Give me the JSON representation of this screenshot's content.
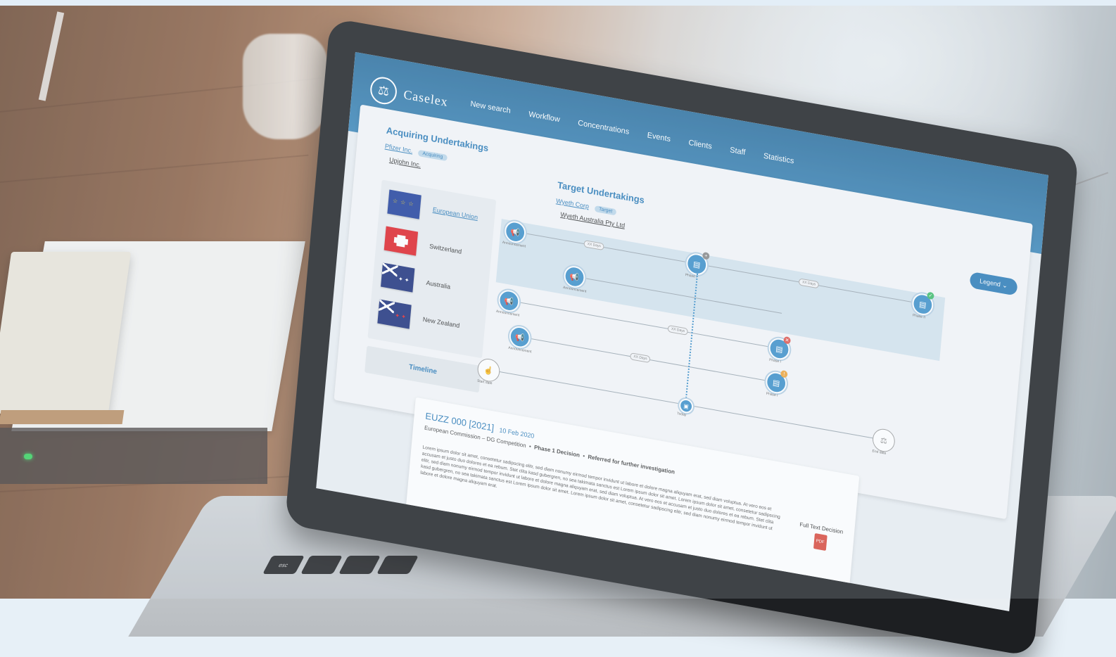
{
  "app": {
    "logo_text": "Caselex",
    "logo_icon": "scales-icon"
  },
  "nav": [
    {
      "label": "New search"
    },
    {
      "label": "Workflow"
    },
    {
      "label": "Concentrations"
    },
    {
      "label": "Events"
    },
    {
      "label": "Clients"
    },
    {
      "label": "Staff"
    },
    {
      "label": "Statistics"
    }
  ],
  "acquiring": {
    "title": "Acquiring Undertakings",
    "primary": "Pfizer Inc.",
    "tag": "Acquiring",
    "secondary": "Upjohn Inc."
  },
  "target": {
    "title": "Target Undertakings",
    "primary": "Wyeth Corp",
    "tag": "Target",
    "secondary": "Wyeth Australia Pty Ltd"
  },
  "countries": [
    {
      "name": "European Union",
      "flag": "eu-flag-icon"
    },
    {
      "name": "Switzerland",
      "flag": "switzerland-flag-icon"
    },
    {
      "name": "Australia",
      "flag": "australia-flag-icon"
    },
    {
      "name": "New Zealand",
      "flag": "new-zealand-flag-icon"
    }
  ],
  "timeline_label": "Timeline",
  "legend_label": "Legend",
  "graph": {
    "announcement": "Announcement",
    "pill_a": "XX Days",
    "pill_b": "XX Days",
    "pill_c": "XX Days",
    "pill_d": "XX Days",
    "phase1": "Phase I",
    "phase2": "Phase II",
    "start": "Start date",
    "today": "Today",
    "end": "End date"
  },
  "decision": {
    "title": "EUZZ 000 [2021]",
    "date": "10 Feb 2020",
    "authority": "European Commission – DG Competition",
    "phase": "Phase 1 Decision",
    "outcome": "Referred for further investigation",
    "body": "Lorem ipsum dolor sit amet, consetetur sadipscing elitr, sed diam nonumy eirmod tempor invidunt ut labore et dolore magna aliquyam erat, sed diam voluptua. At vero eos et accusam et justo duo dolores et ea rebum. Stet clita kasd gubergren, no sea takimata sanctus est Lorem ipsum dolor sit amet. Lorem ipsum dolor sit amet, consetetur sadipscing elitr, sed diam nonumy eirmod tempor invidunt ut labore et dolore magna aliquyam erat, sed diam voluptua. At vero eos et accusam et justo duo dolores et ea rebum. Stet clita kasd gubergren, no sea takimata sanctus est Lorem ipsum dolor sit amet. Lorem ipsum dolor sit amet, consetetur sadipscing elitr, sed diam nonumy eirmod tempor invidunt ut labore et dolore magna aliquyam erat.",
    "full_text_label": "Full Text Decision",
    "pdf_label": "PDF"
  },
  "colors": {
    "accent": "#2a7ab6",
    "header": "#3b86b8",
    "node": "#3b8fc9",
    "success": "#3dbb6a",
    "error": "#e0544b",
    "warning": "#f0a53b"
  }
}
